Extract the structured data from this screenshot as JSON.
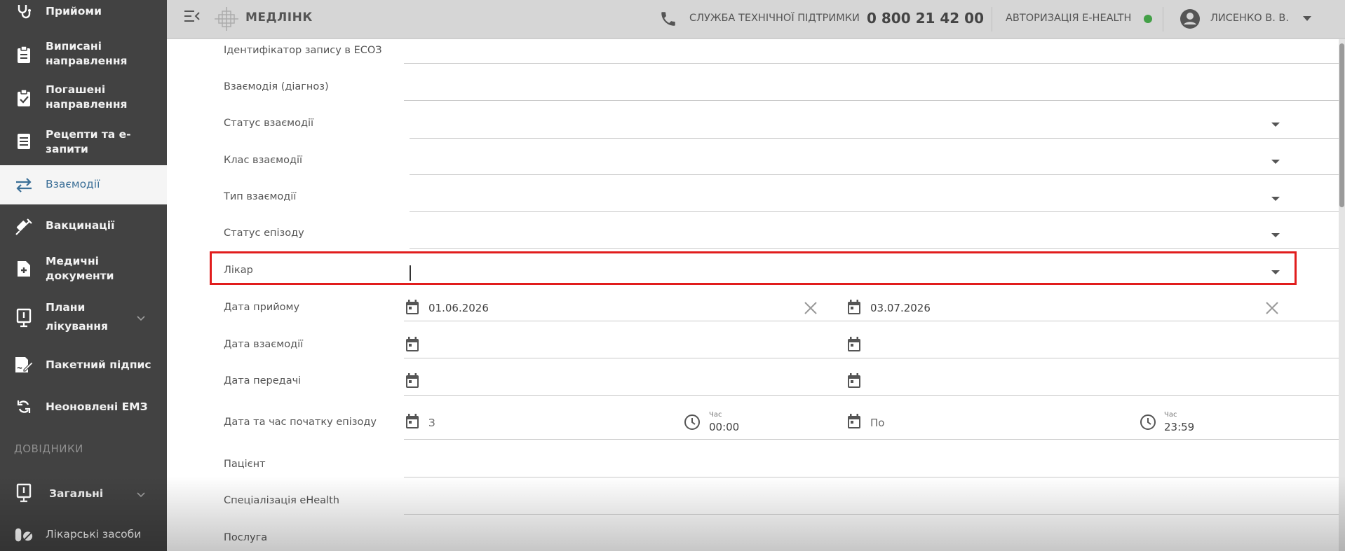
{
  "sidebar": {
    "items": [
      {
        "label": "Прийоми",
        "icon": "stethoscope-icon"
      },
      {
        "label": "Виписані направлення",
        "icon": "clipboard-icon"
      },
      {
        "label": "Погашені направлення",
        "icon": "clipboard-check-icon"
      },
      {
        "label": "Рецепти та е-запити",
        "icon": "document-list-icon"
      },
      {
        "label": "Взаємодії",
        "icon": "swap-arrows-icon"
      },
      {
        "label": "Вакцинації",
        "icon": "syringe-icon"
      },
      {
        "label": "Медичні документи",
        "icon": "medical-document-icon"
      },
      {
        "label": "Плани лікування",
        "icon": "plan-board-icon"
      },
      {
        "label": "Пакетний підпис",
        "icon": "signature-icon"
      },
      {
        "label": "Неоновлені ЕМЗ",
        "icon": "sync-icon"
      }
    ],
    "section_title": "ДОВІДНИКИ",
    "ref_items": [
      {
        "label": "Загальні",
        "icon": "plan-board-icon"
      },
      {
        "label": "Лікарські засоби",
        "icon": "pills-icon"
      }
    ]
  },
  "header": {
    "brand": "МЕДЛІНК",
    "support_label": "СЛУЖБА ТЕХНІЧНОЇ ПІДТРИМКИ",
    "phone": "0 800 21 42 00",
    "auth_label": "АВТОРИЗАЦІЯ E-HEALTH",
    "user_name": "ЛИСЕНКО В. В."
  },
  "form": {
    "record_id_label": "Ідентифікатор запису в ЕСОЗ",
    "diagnosis_label": "Взаємодія (діагноз)",
    "status_label": "Статус взаємодії",
    "class_label": "Клас взаємодії",
    "type_label": "Тип взаємодії",
    "episode_status_label": "Статус епізоду",
    "doctor_label": "Лікар",
    "visit_date_label": "Дата прийому",
    "visit_date_from": "01.06.2026",
    "visit_date_to": "03.07.2026",
    "interaction_date_label": "Дата взаємодії",
    "transfer_date_label": "Дата передачі",
    "episode_start_label": "Дата та час початку епізоду",
    "episode_from_placeholder": "З",
    "episode_to_placeholder": "По",
    "time_label": "Час",
    "time_from": "00:00",
    "time_to": "23:59",
    "patient_label": "Пацієнт",
    "specialization_label": "Спеціалізація eHealth",
    "service_label": "Послуга"
  },
  "colors": {
    "sidebar_bg": "#424242",
    "active_text": "#3b6f97",
    "highlight": "#e11d1d",
    "status_dot": "#43a047"
  }
}
